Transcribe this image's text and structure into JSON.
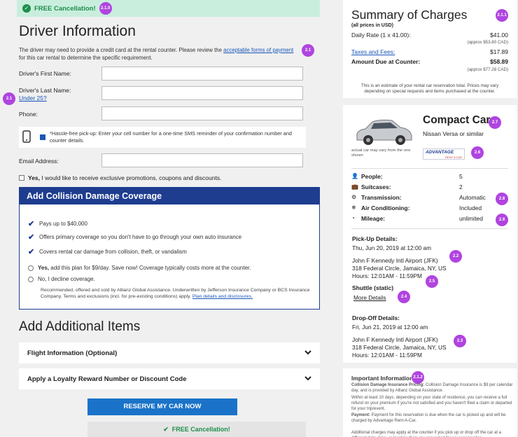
{
  "banner": {
    "text": "FREE Cancellation!",
    "badge": "2.1.0"
  },
  "driver": {
    "title": "Driver Information",
    "note_pre": "The driver may need to provide a credit card at the rental counter. Please review the ",
    "note_link": "acceptable forms of payment",
    "note_post": " for this car rental to determine the specific requirement.",
    "note_badge": "2.1",
    "first_name_label": "Driver's First Name:",
    "last_name_label": "Driver's Last Name:",
    "under25_link": "Under 25?",
    "last_badge": "2.1",
    "phone_label": "Phone:",
    "sms_text": "*Hassle-free pick-up: Enter your cell number for a one-time SMS reminder of your confirmation number and counter details.",
    "email_label": "Email Address:",
    "promo_bold": "Yes,",
    "promo_text": " I would like to receive exclusive promotions, coupons and discounts."
  },
  "cdw": {
    "title": "Add Collision Damage Coverage",
    "bullets": [
      "Pays up to $40,000",
      "Offers primary coverage so you don't have to go through your own auto insurance",
      "Covers rental car damage from collision, theft, or vandalism"
    ],
    "yes_bold": "Yes,",
    "yes_text": " add this plan for $9/day. Save now! Coverage typically costs more at the counter.",
    "no_text": "No, I decline coverage.",
    "legal": "Recommended, offered and sold by Allianz Global Assistance. Underwritten by Jefferson Insurance Company or BCS Insurance Company. Terms and exclusions (incl. for pre-existing conditions) apply.",
    "legal_link": "Plan details and disclosures."
  },
  "additional": {
    "title": "Add Additional Items",
    "flight": "Flight Information (Optional)",
    "loyalty": "Apply a Loyalty Reward Number or Discount Code",
    "reserve": "RESERVE MY CAR NOW",
    "free": "FREE Cancellation!"
  },
  "summary": {
    "title": "Summary of Charges",
    "badge": "2.1.1",
    "usd": "(all prices in USD)",
    "daily_label": "Daily Rate (1 x 41.00):",
    "daily_value": "$41.00",
    "daily_approx": "(approx $53.80 CAD)",
    "taxes_label": "Taxes and Fees:",
    "taxes_value": "$17.89",
    "due_label": "Amount Due at Counter:",
    "due_value": "$58.89",
    "due_approx": "(approx $77.28 CAD)",
    "fine": "This is an estimate of your rental car reservation total. Prices may vary depending on special requests and items purchased at the counter."
  },
  "car": {
    "title": "Compact Car",
    "title_badge": "2.7",
    "model": "Nissan Versa or similar",
    "caption": "actual car may vary from the one shown",
    "vendor": "ADVANTAGE",
    "vendor_sub": "RENT A CAR",
    "vendor_badge": "2.6",
    "specs": [
      {
        "label": "People:",
        "value": "5",
        "bold": false
      },
      {
        "label": "Suitcases:",
        "value": "2",
        "bold": false
      },
      {
        "label": "Transmission:",
        "value": "Automatic",
        "bold": true,
        "badge": "2.8"
      },
      {
        "label": "Air Conditioning:",
        "value": "Included",
        "bold": true
      },
      {
        "label": "Mileage:",
        "value": "unlimited",
        "bold": true,
        "badge": "2.9"
      }
    ],
    "pickup_h": "Pick-Up Details:",
    "pickup_date": "Thu, Jun 20, 2019 at 12:00 am",
    "pickup_badge": "2.2",
    "pickup_loc": "John F Kennedy Intl Airport (JFK)",
    "pickup_addr": "318 Federal Circle, Jamaica, NY, US",
    "pickup_hours": "Hours: 12:01AM - 11:59PM",
    "hours_badge": "2.5",
    "shuttle_h": "Shuttle (static)",
    "more": "More Details",
    "more_badge": "2.4",
    "drop_h": "Drop-Off Details:",
    "drop_date": "Fri, Jun 21, 2019 at 12:00 am",
    "drop_badge": "2.3",
    "drop_loc": "John F Kennedy Intl Airport (JFK)",
    "drop_addr": "318 Federal Circle, Jamaica, NY, US",
    "drop_hours": "Hours: 12:01AM - 11:59PM"
  },
  "important": {
    "title": "Important Information",
    "badge": "2.1.2",
    "p1_bold": "Collision Damage Insurance Pricing:",
    "p1": " Collision Damage Insurance is $9 per calendar day, and is provided by Allianz Global Assistance.",
    "p2": "Within at least 10 days, depending on your state of residence, you can receive a full refund on your premium if you're not satisfied and you haven't filed a claim or departed for your trip/event.",
    "p3_bold": "Payment:",
    "p3": " Payment for this reservation is due when the car is picked up and will be charged by Advantage Rent-A-Car.",
    "p4": "Additional charges may apply at the counter if you pick up or drop off the car at a different date, time, or location than you requested for your reservation."
  }
}
